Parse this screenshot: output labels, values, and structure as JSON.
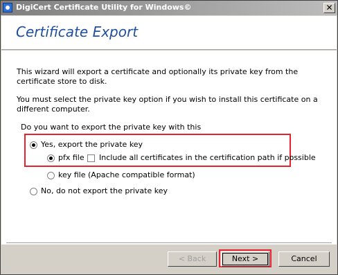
{
  "window": {
    "title": "DigiCert Certificate Utility for Windows©",
    "close_glyph": "✕"
  },
  "header": {
    "title": "Certificate Export"
  },
  "content": {
    "intro": "This wizard will export a certificate and optionally its private key from the certificate store to disk.",
    "note": "You must select the private key option if you wish to install this certificate on a different computer.",
    "question": "Do you want to export the private key with this",
    "option_yes": "Yes, export the private key",
    "option_pfx": "pfx file",
    "include_all": "Include all certificates in the certification path if possible",
    "option_key": "key file (Apache compatible format)",
    "option_no": "No, do not export the private key"
  },
  "state": {
    "yes_selected": true,
    "pfx_selected": true,
    "include_all_checked": false
  },
  "footer": {
    "back": "< Back",
    "next": "Next >",
    "cancel": "Cancel"
  },
  "colors": {
    "highlight": "#e8212e",
    "header_title": "#1f4e9b"
  }
}
